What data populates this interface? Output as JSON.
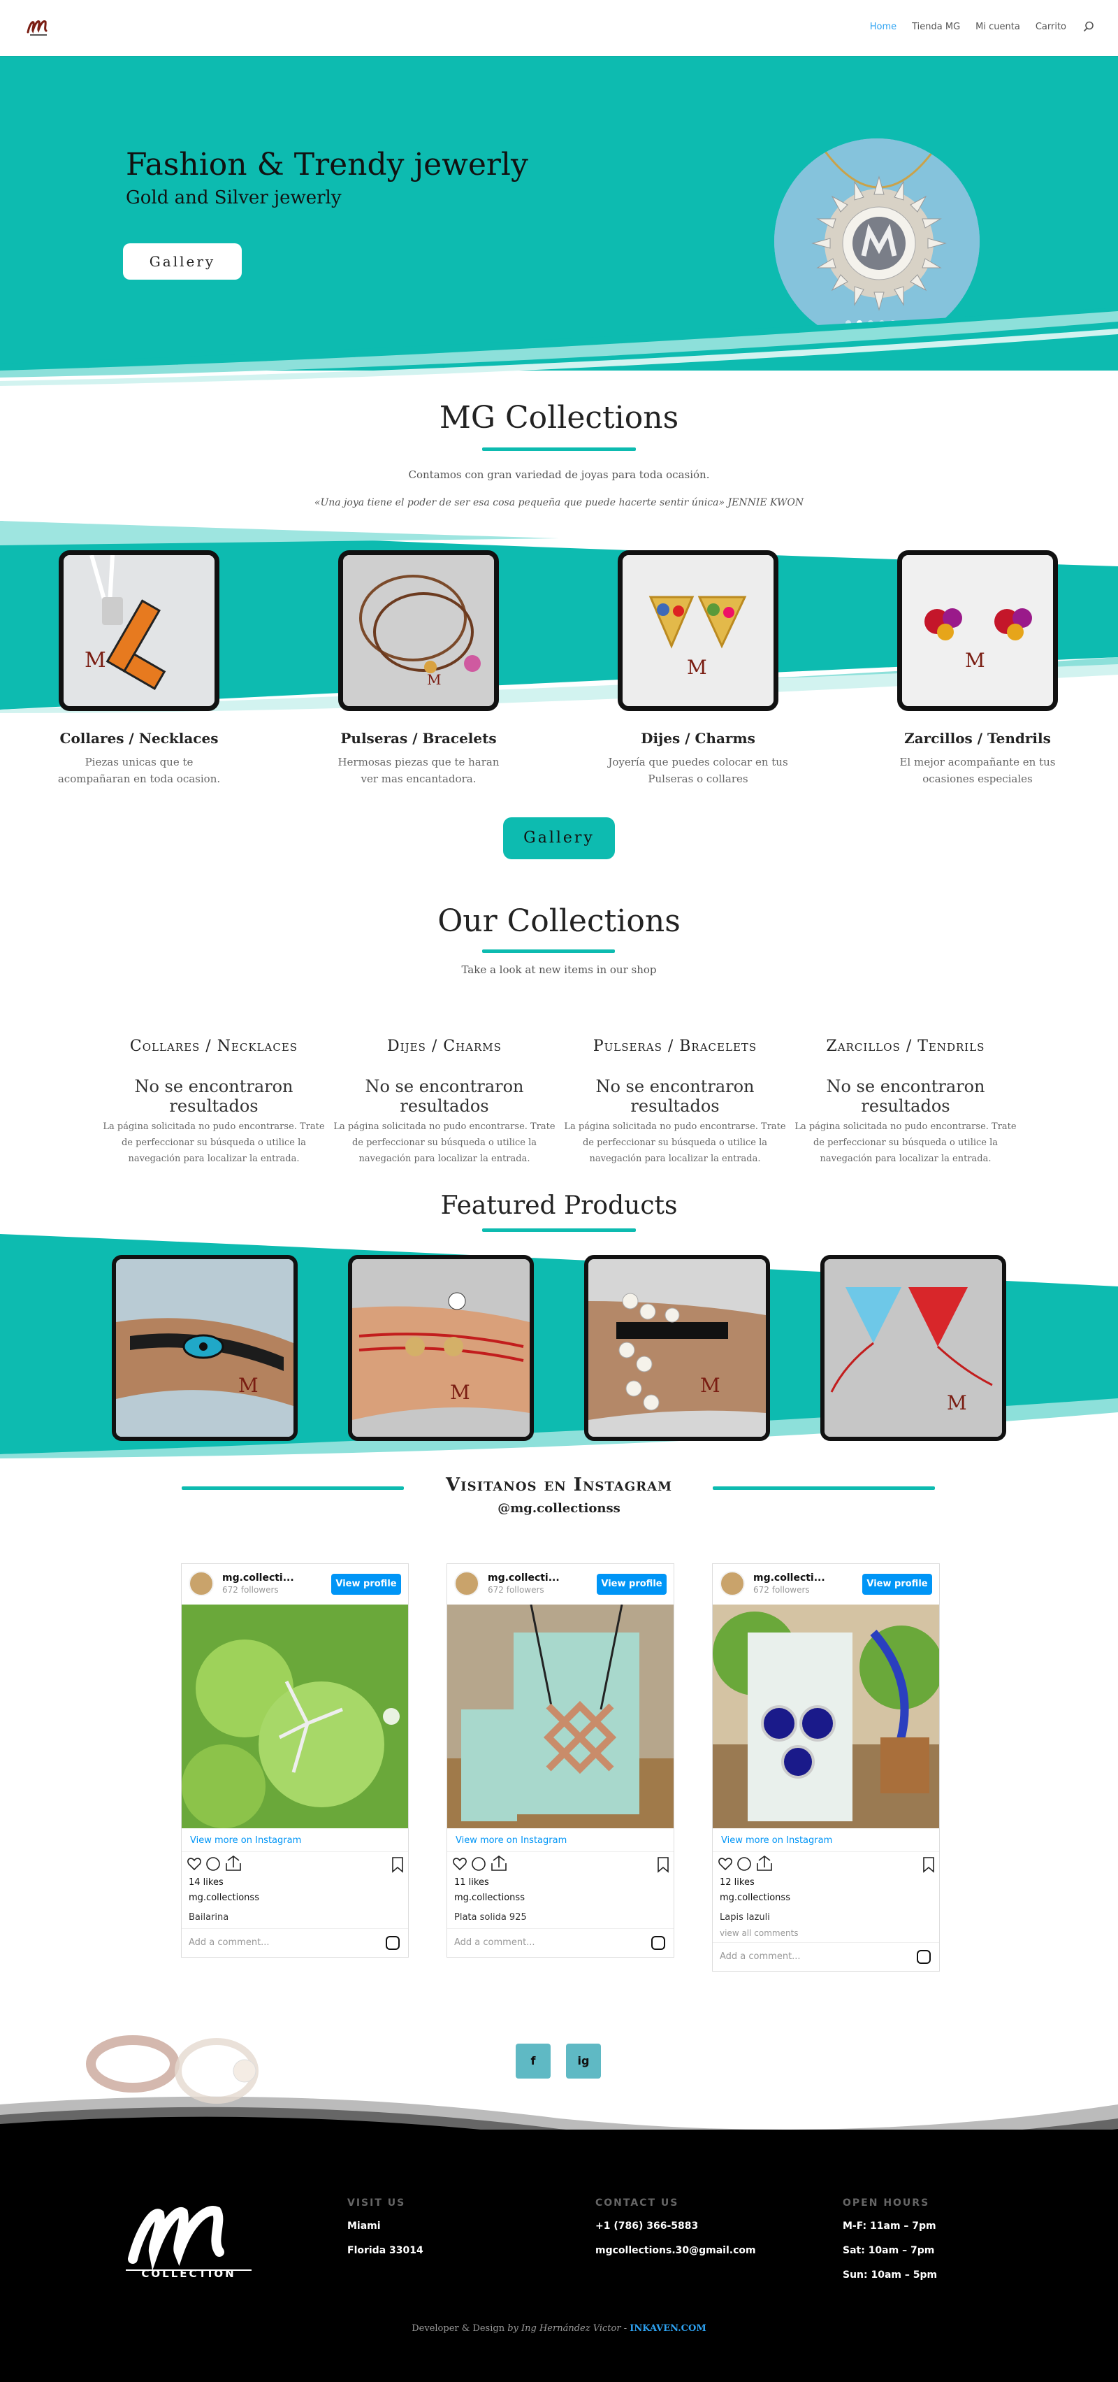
{
  "nav": {
    "logo_alt": "MG",
    "items": [
      "Home",
      "Tienda MG",
      "Mi cuenta",
      "Carrito"
    ],
    "active": "Home"
  },
  "hero": {
    "title": "Fashion & Trendy jewerly",
    "subtitle": "Gold and Silver jewerly",
    "button": "Gallery",
    "slides": 6,
    "active_slide": 2
  },
  "mg_collections": {
    "title": "MG Collections",
    "line1": "Contamos con gran variedad de joyas para toda ocasión.",
    "line2": "«Una joya tiene el poder de ser esa cosa pequeña que puede hacerte sentir única» JENNIE KWON",
    "categories": [
      {
        "title": "Collares / Necklaces",
        "desc": "Piezas unicas que te acompañaran en toda ocasion."
      },
      {
        "title": "Pulseras / Bracelets",
        "desc": "Hermosas piezas que te haran ver mas encantadora."
      },
      {
        "title": "Dijes / Charms",
        "desc": "Joyería que puedes colocar en tus Pulseras o collares"
      },
      {
        "title": "Zarcillos / Tendrils",
        "desc": "El mejor acompañante en tus ocasiones especiales"
      }
    ],
    "button": "Gallery"
  },
  "our_collections": {
    "title": "Our Collections",
    "subtitle": "Take a look at new items in our shop",
    "columns": [
      {
        "title": "Collares / Necklaces",
        "none": "No se encontraron resultados",
        "msg": "La página solicitada no pudo encontrarse. Trate de perfeccionar su búsqueda o utilice la navegación para localizar la entrada."
      },
      {
        "title": "Dijes / Charms",
        "none": "No se encontraron resultados",
        "msg": "La página solicitada no pudo encontrarse. Trate de perfeccionar su búsqueda o utilice la navegación para localizar la entrada."
      },
      {
        "title": "Pulseras / Bracelets",
        "none": "No se encontraron resultados",
        "msg": "La página solicitada no pudo encontrarse. Trate de perfeccionar su búsqueda o utilice la navegación para localizar la entrada."
      },
      {
        "title": "Zarcillos / Tendrils",
        "none": "No se encontraron resultados",
        "msg": "La página solicitada no pudo encontrarse. Trate de perfeccionar su búsqueda o utilice la navegación para localizar la entrada."
      }
    ]
  },
  "featured": {
    "title": "Featured Products"
  },
  "instagram": {
    "title": "Visitanos en Instagram",
    "handle": "@mg.collectionss",
    "posts": [
      {
        "user": "mg.collecti...",
        "followers": "672 followers",
        "view_profile": "View profile",
        "view_more": "View more on Instagram",
        "likes": "14 likes",
        "username": "mg.collectionss",
        "caption": "Bailarina",
        "view_all": "",
        "add_comment": "Add a comment..."
      },
      {
        "user": "mg.collecti...",
        "followers": "672 followers",
        "view_profile": "View profile",
        "view_more": "View more on Instagram",
        "likes": "11 likes",
        "username": "mg.collectionss",
        "caption": "Plata solida 925",
        "view_all": "",
        "add_comment": "Add a comment..."
      },
      {
        "user": "mg.collecti...",
        "followers": "672 followers",
        "view_profile": "View profile",
        "view_more": "View more on Instagram",
        "likes": "12 likes",
        "username": "mg.collectionss",
        "caption": "Lapis lazuli",
        "view_all": "view all comments",
        "add_comment": "Add a comment..."
      }
    ]
  },
  "social": {
    "facebook": "f",
    "instagram": "ig"
  },
  "footer": {
    "logo_text": "COLLECTION",
    "visit_title": "VISIT US",
    "visit_lines": [
      "Miami",
      "Florida 33014"
    ],
    "contact_title": "CONTACT US",
    "contact_lines": [
      "+1 (786) 366-5883",
      "mgcollections.30@gmail.com"
    ],
    "hours_title": "OPEN HOURS",
    "hours_lines": [
      "M-F: 11am – 7pm",
      "Sat: 10am – 7pm",
      "Sun: 10am – 5pm"
    ],
    "credit_a": "Developer & Design",
    "credit_b": " by Ing Hernández Victor - ",
    "credit_link": "INKAVEN.COM"
  },
  "colors": {
    "teal": "#0dbbb0",
    "link": "#2ea3f2",
    "ig_blue": "#0095f6",
    "social": "#5fb9c4"
  }
}
